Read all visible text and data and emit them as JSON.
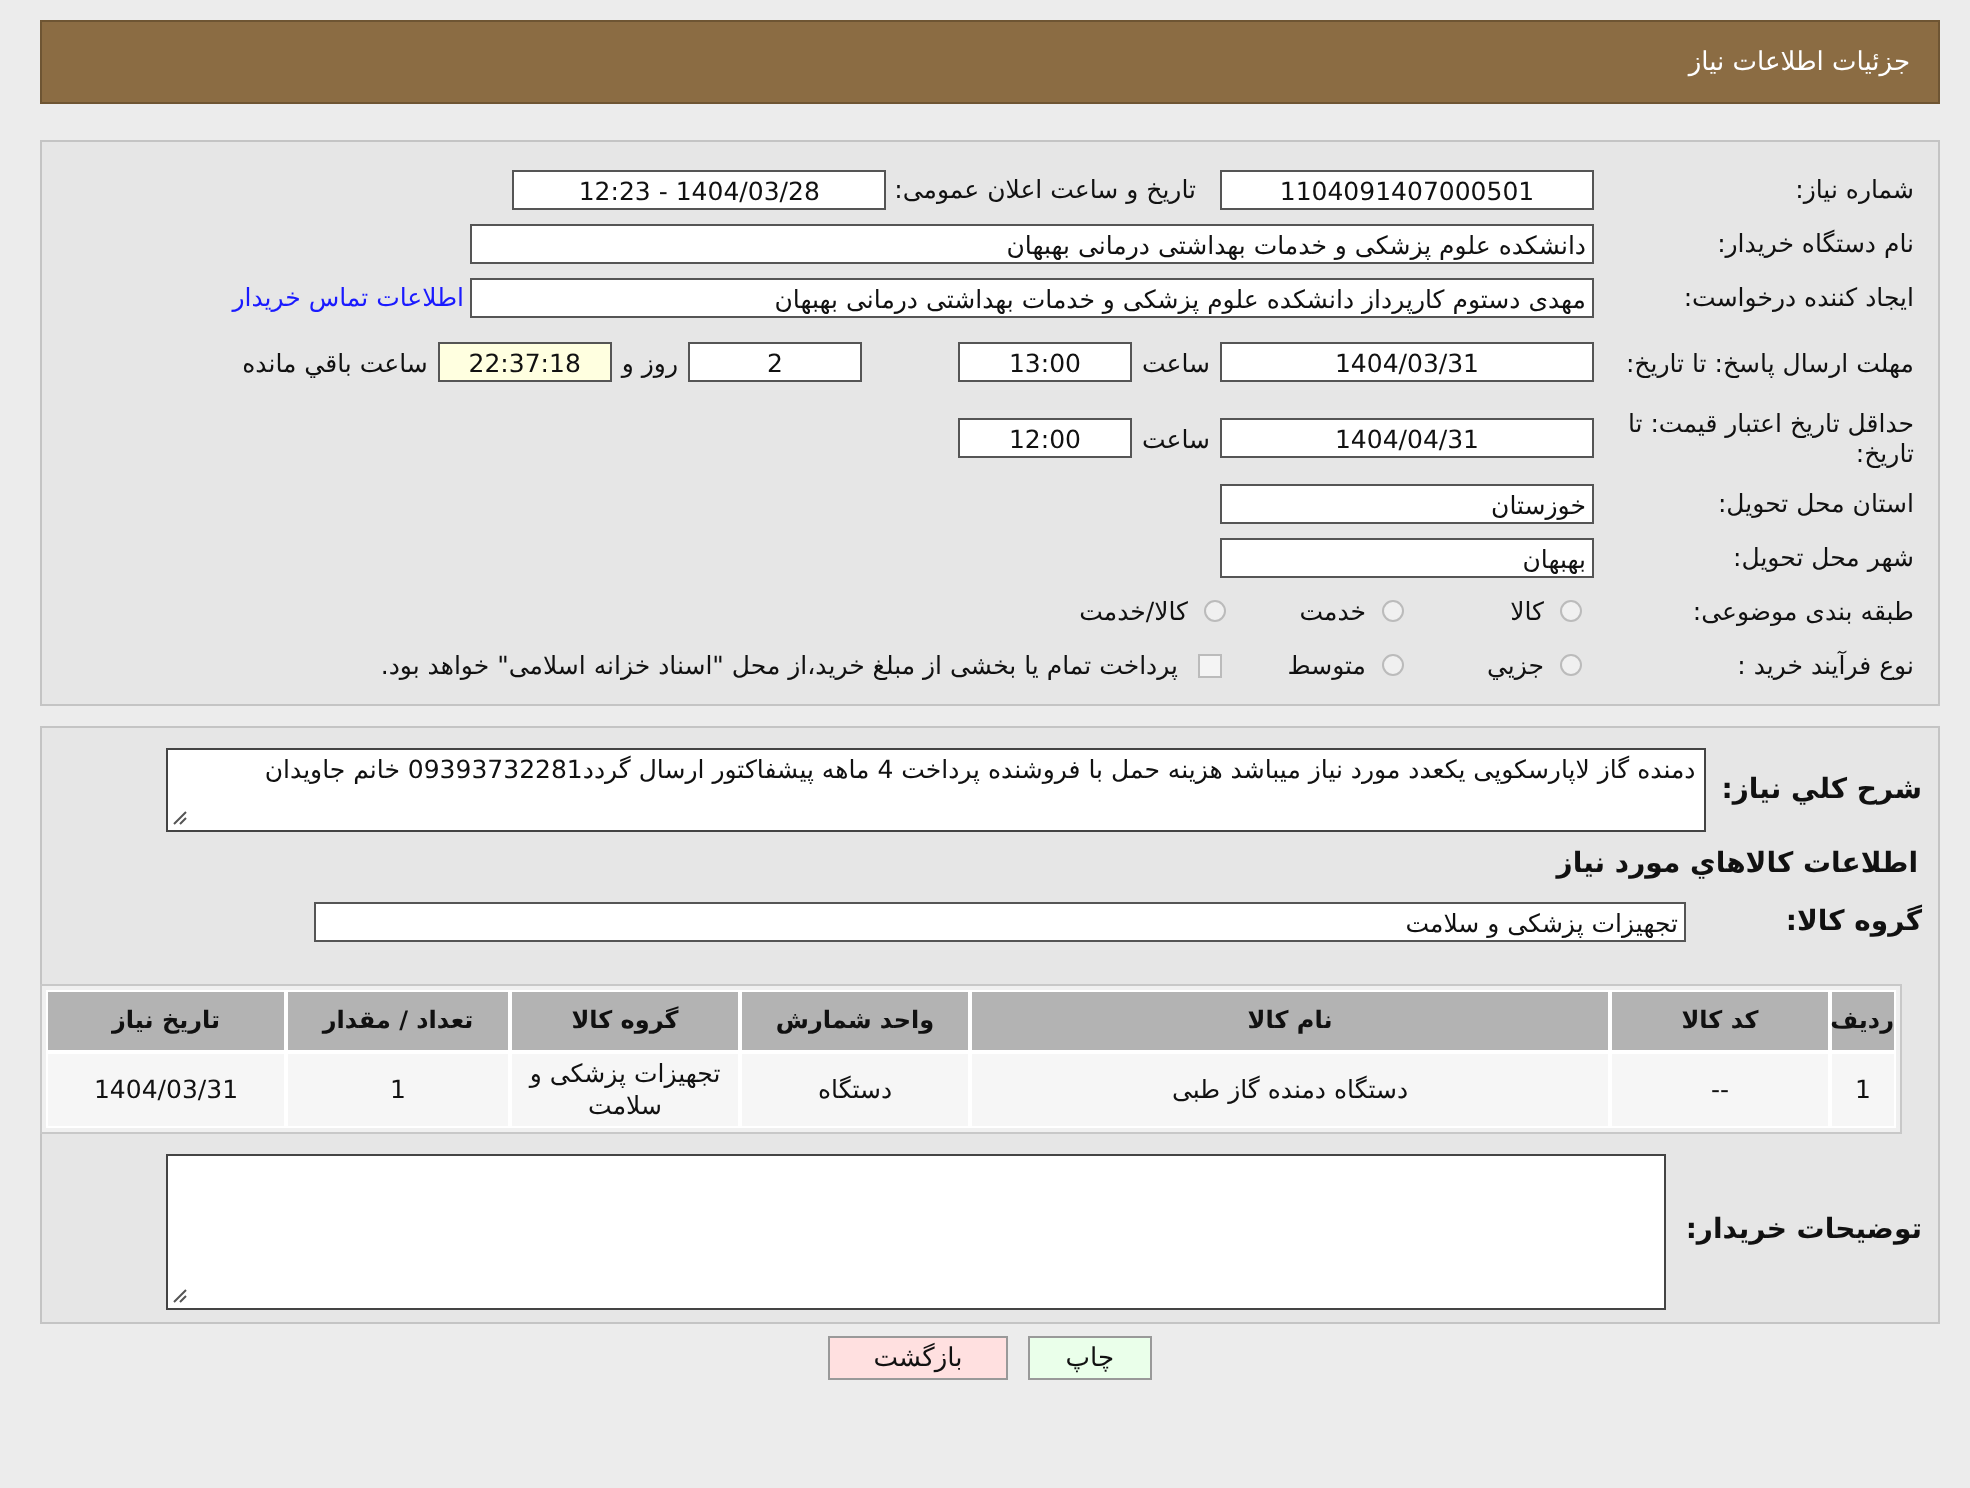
{
  "page_title": "جزئیات اطلاعات نیاز",
  "need_number": {
    "label": "شماره نیاز:",
    "value": "1104091407000501"
  },
  "announce": {
    "label": "تاریخ و ساعت اعلان عمومی:",
    "value": "1404/03/28 - 12:23"
  },
  "buyer": {
    "label": "نام دستگاه خریدار:",
    "value": "دانشکده علوم پزشکی و خدمات بهداشتی  درمانی بهبهان"
  },
  "requester": {
    "label": "ایجاد کننده درخواست:",
    "value": "مهدی دستوم کارپرداز دانشکده علوم پزشکی و خدمات بهداشتی  درمانی بهبهان",
    "link": "اطلاعات تماس خریدار"
  },
  "reply_deadline": {
    "label": "مهلت ارسال پاسخ: تا تاریخ:",
    "date": "1404/03/31",
    "time_label": "ساعت",
    "time": "13:00",
    "days": "2",
    "days_label": "روز و",
    "remaining": "22:37:18",
    "remaining_label": "ساعت باقي مانده"
  },
  "price_validity": {
    "label": "حداقل تاریخ اعتبار قیمت: تا تاریخ:",
    "date": "1404/04/31",
    "time_label": "ساعت",
    "time": "12:00"
  },
  "province": {
    "label": "استان محل تحویل:",
    "value": "خوزستان"
  },
  "city": {
    "label": "شهر محل تحویل:",
    "value": "بهبهان"
  },
  "category": {
    "label": "طبقه بندی موضوعی:",
    "options": [
      {
        "label": "کالا",
        "selected": false
      },
      {
        "label": "خدمت",
        "selected": false
      },
      {
        "label": "کالا/خدمت",
        "selected": false
      }
    ]
  },
  "process": {
    "label": "نوع فرآیند خرید :",
    "options": [
      {
        "label": "جزيي",
        "selected": false
      },
      {
        "label": "متوسط",
        "selected": false
      }
    ],
    "payment_note": {
      "text": "پرداخت تمام یا بخشی از مبلغ خرید،از محل \"اسناد خزانه اسلامی\" خواهد بود.",
      "checked": false
    }
  },
  "description": {
    "label": "شرح كلي نياز:",
    "text": "دمنده گاز لاپارسکوپی یکعدد مورد نیاز میباشد هزینه حمل با فروشنده پرداخت 4 ماهه پیشفاکتور ارسال گردد09393732281 خانم جاویدان"
  },
  "goods_heading": "اطلاعات كالاهاي مورد نياز",
  "goods_group": {
    "label": "گروه کالا:",
    "value": "تجهیزات پزشکی و سلامت"
  },
  "table": {
    "columns": [
      "ردیف",
      "کد کالا",
      "نام کالا",
      "واحد شمارش",
      "گروه کالا",
      "تعداد / مقدار",
      "تاریخ نیاز"
    ],
    "rows": [
      [
        "1",
        "--",
        "دستگاه دمنده گاز طبی",
        "دستگاه",
        "تجهیزات پزشکی و سلامت",
        "1",
        "1404/03/31"
      ]
    ]
  },
  "buyer_notes": {
    "label": "توضیحات خریدار:"
  },
  "buttons": [
    {
      "label": "چاپ",
      "kind": "print"
    },
    {
      "label": "بازگشت",
      "kind": "back"
    }
  ]
}
